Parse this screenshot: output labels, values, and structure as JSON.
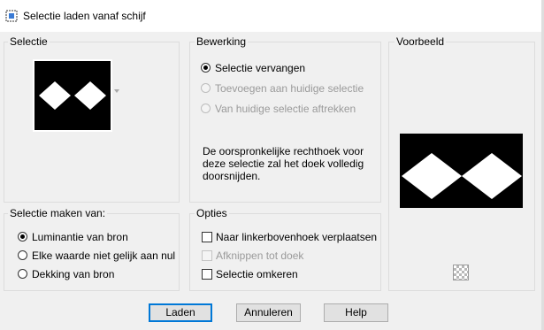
{
  "window": {
    "title": "Selectie laden vanaf schijf"
  },
  "selectie": {
    "legend": "Selectie"
  },
  "bewerking": {
    "legend": "Bewerking",
    "options": [
      {
        "label": "Selectie vervangen",
        "selected": true,
        "enabled": true
      },
      {
        "label": "Toevoegen aan huidige selectie",
        "selected": false,
        "enabled": false
      },
      {
        "label": "Van huidige selectie aftrekken",
        "selected": false,
        "enabled": false
      }
    ],
    "info_lines": [
      "De oorspronkelijke rechthoek voor",
      "deze selectie zal het doek volledig",
      "doorsnijden."
    ]
  },
  "voorbeeld": {
    "legend": "Voorbeeld"
  },
  "maken_van": {
    "legend": "Selectie maken van:",
    "options": [
      {
        "label": "Luminantie van bron",
        "selected": true
      },
      {
        "label": "Elke waarde niet gelijk aan nul",
        "selected": false
      },
      {
        "label": "Dekking van bron",
        "selected": false
      }
    ]
  },
  "opties": {
    "legend": "Opties",
    "checks": [
      {
        "label": "Naar linkerbovenhoek verplaatsen",
        "checked": false,
        "enabled": true
      },
      {
        "label": "Afknippen tot doek",
        "checked": false,
        "enabled": false
      },
      {
        "label": "Selectie omkeren",
        "checked": false,
        "enabled": true
      }
    ]
  },
  "buttons": {
    "load": "Laden",
    "cancel": "Annuleren",
    "help": "Help"
  },
  "icons": {
    "app": "selection-app-icon",
    "transparency": "checkerboard-icon"
  }
}
